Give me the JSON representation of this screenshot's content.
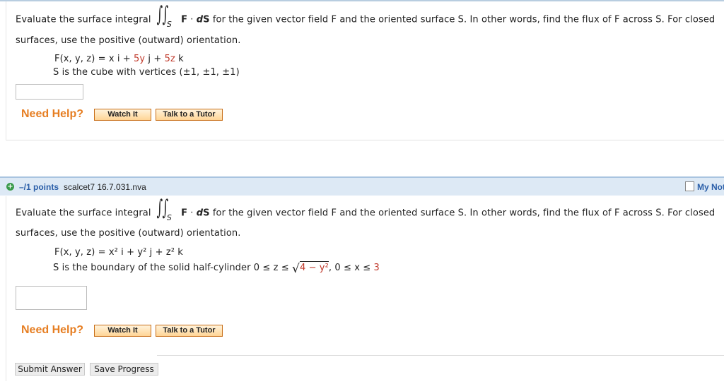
{
  "help": {
    "label": "Need Help?",
    "watch": "Watch It",
    "tutor": "Talk to a Tutor"
  },
  "integral": {
    "symbol": "∫",
    "sub": "S"
  },
  "q1": {
    "pre": "Evaluate the surface integral",
    "post": "for the given vector field F and the oriented surface S. In other words, find the flux of F across S. For closed",
    "line2": "surfaces, use the positive (outward) orientation.",
    "field_a": "F(x, y, z) = x i + ",
    "field_b": "5y",
    "field_c": " j + ",
    "field_d": "5z",
    "field_e": " k",
    "surface": "S is the cube with vertices (±1, ±1, ±1)"
  },
  "header": {
    "points": "–/1 points",
    "source": "scalcet7 16.7.031.nva",
    "my_notes": "My Notes"
  },
  "q2": {
    "pre": "Evaluate the surface integral",
    "post": "for the given vector field F and the oriented surface S. In other words, find the flux of F across S. For closed",
    "line2": "surfaces, use the positive (outward) orientation.",
    "field": "F(x, y, z) = x² i + y² j + z² k",
    "surface_a": "S is the boundary of the solid half-cylinder  0 ≤ z ≤ ",
    "radical": "√",
    "surface_b": "4 − y²",
    "surface_c": ", 0 ≤ x ≤ ",
    "surface_d": "3"
  },
  "buttons": {
    "submit": "Submit Answer",
    "save": "Save Progress"
  }
}
